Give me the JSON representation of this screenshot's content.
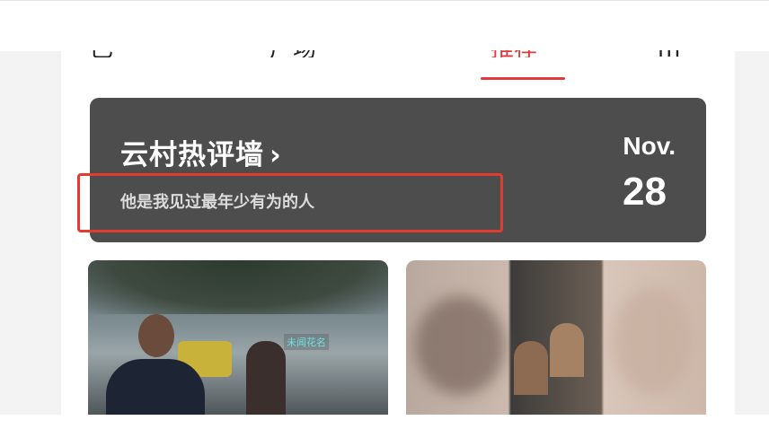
{
  "nav": {
    "tabs": [
      {
        "label": "已",
        "active": false
      },
      {
        "label": "广场",
        "active": false
      },
      {
        "label": "推荐",
        "active": true
      },
      {
        "label": "m",
        "active": false
      }
    ]
  },
  "banner": {
    "title": "云村热评墙",
    "chevron": "›",
    "subtitle": "他是我见过最年少有为的人",
    "date_month": "Nov.",
    "date_day": "28"
  },
  "thumbnails": [
    {
      "id": "left",
      "tag": "未闻花名"
    },
    {
      "id": "right"
    }
  ],
  "colors": {
    "accent": "#e03a3a",
    "banner_bg": "#4d4d4d",
    "highlight": "#e33b2e"
  }
}
